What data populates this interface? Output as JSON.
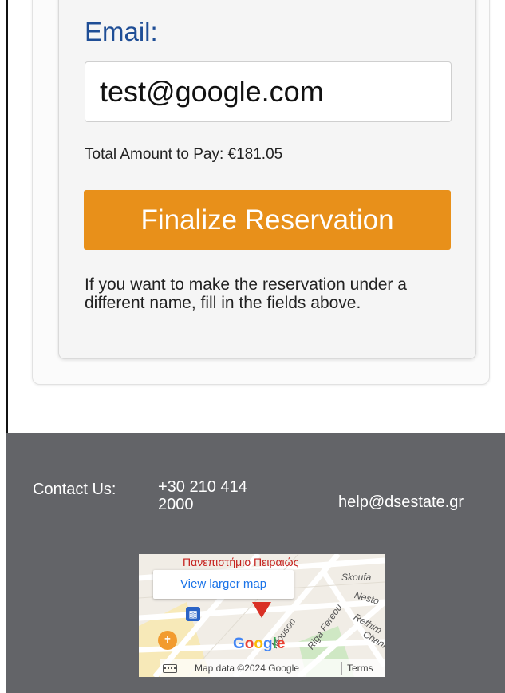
{
  "form": {
    "email_label": "Email:",
    "email_value": "test@google.com",
    "total_line": "Total Amount to Pay: €181.05",
    "finalize_label": "Finalize Reservation",
    "hint": "If you want to make the reservation under a different name, fill in the fields above."
  },
  "footer": {
    "contact_label": "Contact Us:",
    "phone": "+30 210 414 2000",
    "email": "help@dsestate.gr"
  },
  "map": {
    "place_name": "Πανεπιστήμιο Πειραιώς",
    "view_larger": "View larger map",
    "streets": [
      "Skoufa",
      "Nesto",
      "Rethim",
      "Chani",
      "Riga Fereou",
      "Mouson"
    ],
    "attribution": "Map data ©2024 Google",
    "terms": "Terms"
  },
  "colors": {
    "accent": "#e8901a",
    "label_blue": "#1f4e96",
    "footer_bg": "#636468",
    "map_pin": "#d93025"
  },
  "icons": [
    "map-pin-icon",
    "transit-icon",
    "restaurant-icon",
    "keyboard-icon"
  ]
}
